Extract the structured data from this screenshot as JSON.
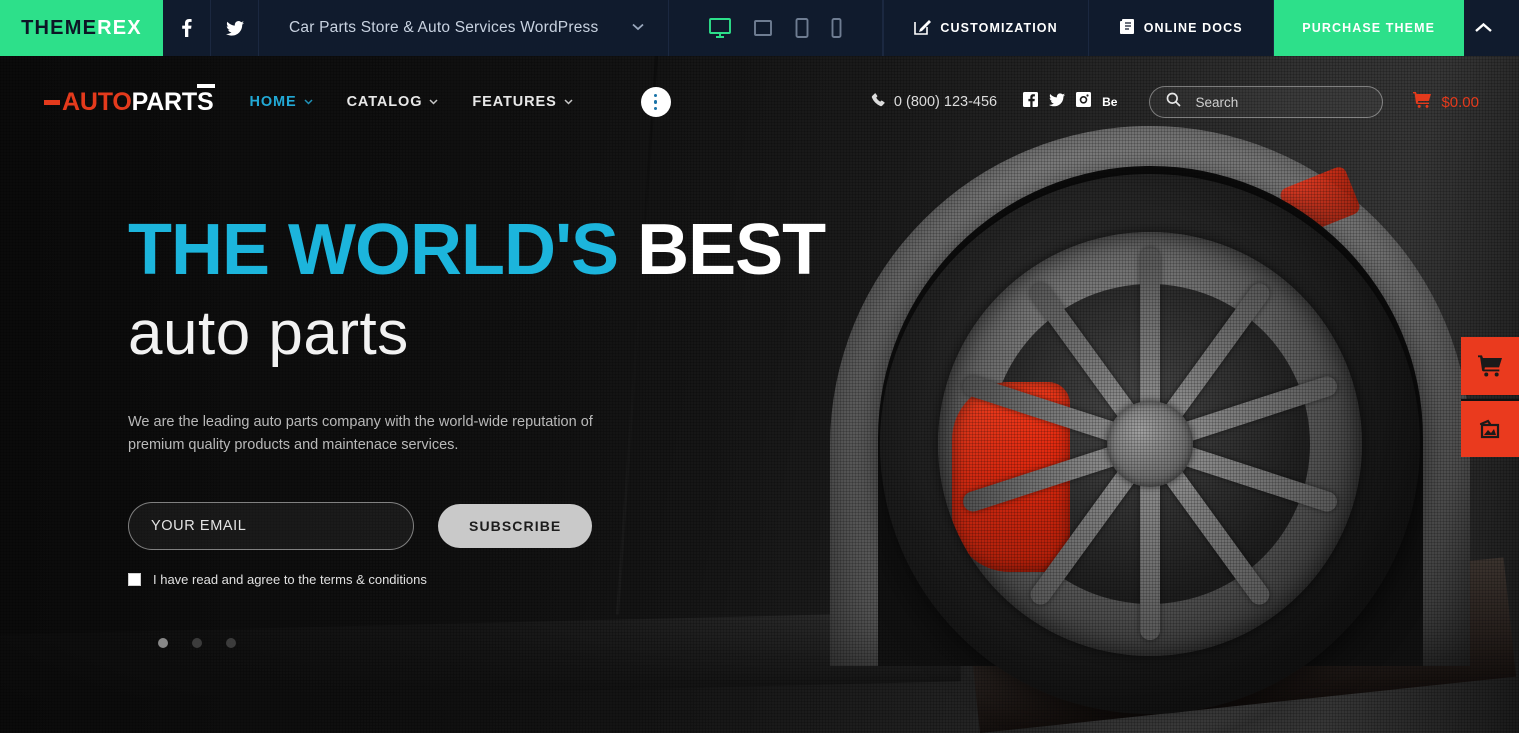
{
  "topbar": {
    "logo_dark": "THEME",
    "logo_light": "REX",
    "social": [
      {
        "name": "facebook-icon",
        "glyph": "f"
      },
      {
        "name": "twitter-icon",
        "glyph": "t"
      }
    ],
    "demo_title": "Car Parts Store & Auto Services WordPress",
    "chevron": "⌄",
    "devices": [
      {
        "name": "desktop",
        "active": true
      },
      {
        "name": "laptop",
        "active": false
      },
      {
        "name": "tablet",
        "active": false
      },
      {
        "name": "mobile",
        "active": false
      }
    ],
    "customization_label": "CUSTOMIZATION",
    "online_docs_label": "ONLINE DOCS",
    "purchase_label": "PURCHASE THEME",
    "accent_green": "#2de08a",
    "bar_bg": "#101b2d"
  },
  "header": {
    "brand": {
      "auto": "AUTO",
      "parts": "PARTS"
    },
    "nav": [
      {
        "label": "HOME",
        "active": true,
        "caret": "⌄"
      },
      {
        "label": "CATALOG",
        "active": false,
        "caret": "⌄"
      },
      {
        "label": "FEATURES",
        "active": false,
        "caret": "⌄"
      }
    ],
    "more_button": "more-options",
    "phone": "0 (800) 123-456",
    "socials": [
      {
        "name": "facebook-icon"
      },
      {
        "name": "twitter-icon"
      },
      {
        "name": "instagram-icon"
      },
      {
        "name": "behance-icon"
      }
    ],
    "search_placeholder": "Search",
    "search_value": "",
    "cart_total": "$0.00",
    "cart_color": "#e43a1c",
    "nav_active_color": "#22a9d6"
  },
  "hero": {
    "title_blue": "THE WORLD'S",
    "title_white": "BEST",
    "subtitle": "auto parts",
    "description": "We are the leading auto parts company with the world-wide reputation of premium quality products and maintenace services.",
    "email_placeholder": "YOUR EMAIL",
    "email_value": "",
    "subscribe_label": "SUBSCRIBE",
    "terms_label": "I have read and agree to the terms & conditions",
    "terms_checked": false,
    "slides": [
      {
        "active": true
      },
      {
        "active": false
      },
      {
        "active": false
      }
    ],
    "blue": "#1cb5dc"
  },
  "side_buttons": [
    {
      "name": "cart-button"
    },
    {
      "name": "gallery-button"
    }
  ]
}
